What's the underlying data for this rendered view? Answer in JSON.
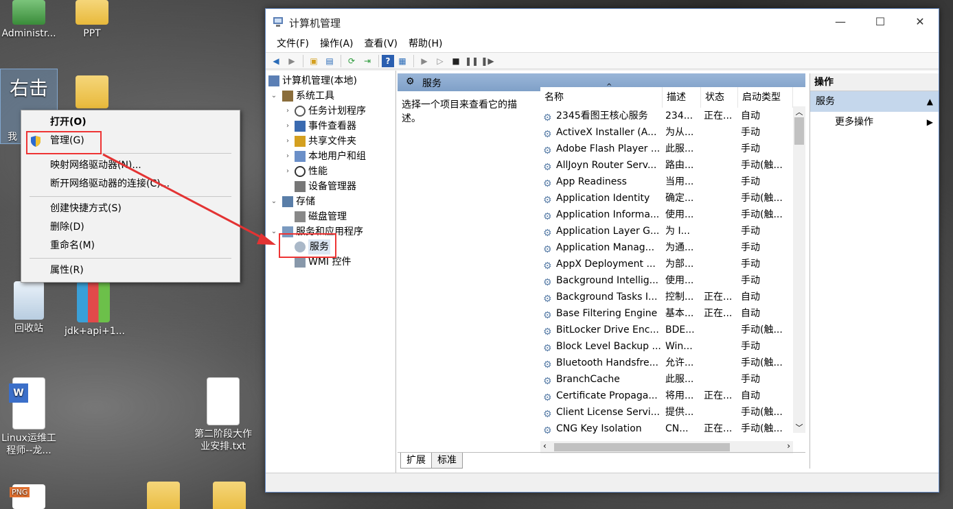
{
  "desktop": {
    "icons": [
      {
        "label": "Administr..."
      },
      {
        "label": "PPT"
      },
      {
        "label": "回收站"
      },
      {
        "label": "jdk+api+1..."
      },
      {
        "label": "Linux运维工程师--龙..."
      },
      {
        "label": "第二阶段大作业安排.txt"
      }
    ],
    "annotation_text": "右击",
    "partial_label": "我"
  },
  "context_menu": {
    "items": [
      "打开(O)",
      "管理(G)",
      "映射网络驱动器(N)...",
      "断开网络驱动器的连接(C)...",
      "创建快捷方式(S)",
      "删除(D)",
      "重命名(M)",
      "属性(R)"
    ]
  },
  "window": {
    "title": "计算机管理",
    "menu": [
      "文件(F)",
      "操作(A)",
      "查看(V)",
      "帮助(H)"
    ],
    "tree": {
      "root": "计算机管理(本地)",
      "system_tools": "系统工具",
      "task_scheduler": "任务计划程序",
      "event_viewer": "事件查看器",
      "shared_folders": "共享文件夹",
      "local_users": "本地用户和组",
      "performance": "性能",
      "device_manager": "设备管理器",
      "storage": "存储",
      "disk_mgmt": "磁盘管理",
      "services_apps": "服务和应用程序",
      "services": "服务",
      "wmi": "WMI 控件"
    },
    "center": {
      "header": "服务",
      "description": "选择一个项目来查看它的描述。",
      "columns": [
        "名称",
        "描述",
        "状态",
        "启动类型"
      ],
      "rows": [
        [
          "2345看图王核心服务",
          "234...",
          "正在...",
          "自动"
        ],
        [
          "ActiveX Installer (A...",
          "为从...",
          "",
          "手动"
        ],
        [
          "Adobe Flash Player ...",
          "此服...",
          "",
          "手动"
        ],
        [
          "AllJoyn Router Serv...",
          "路由...",
          "",
          "手动(触..."
        ],
        [
          "App Readiness",
          "当用...",
          "",
          "手动"
        ],
        [
          "Application Identity",
          "确定...",
          "",
          "手动(触..."
        ],
        [
          "Application Informa...",
          "使用...",
          "",
          "手动(触..."
        ],
        [
          "Application Layer G...",
          "为 I...",
          "",
          "手动"
        ],
        [
          "Application Manag...",
          "为通...",
          "",
          "手动"
        ],
        [
          "AppX Deployment ...",
          "为部...",
          "",
          "手动"
        ],
        [
          "Background Intellig...",
          "使用...",
          "",
          "手动"
        ],
        [
          "Background Tasks I...",
          "控制...",
          "正在...",
          "自动"
        ],
        [
          "Base Filtering Engine",
          "基本...",
          "正在...",
          "自动"
        ],
        [
          "BitLocker Drive Enc...",
          "BDE...",
          "",
          "手动(触..."
        ],
        [
          "Block Level Backup ...",
          "Win...",
          "",
          "手动"
        ],
        [
          "Bluetooth Handsfre...",
          "允许...",
          "",
          "手动(触..."
        ],
        [
          "BranchCache",
          "此服...",
          "",
          "手动"
        ],
        [
          "Certificate Propaga...",
          "将用...",
          "正在...",
          "自动"
        ],
        [
          "Client License Servi...",
          "提供...",
          "",
          "手动(触..."
        ],
        [
          "CNG Key Isolation",
          "CN...",
          "正在...",
          "手动(触..."
        ]
      ],
      "tabs": [
        "扩展",
        "标准"
      ]
    },
    "actions": {
      "header": "操作",
      "section": "服务",
      "more": "更多操作"
    }
  },
  "colors": {
    "highlight": "#e33333",
    "header_blue": "#7fa0c8",
    "section_blue": "#c5d7ec"
  }
}
